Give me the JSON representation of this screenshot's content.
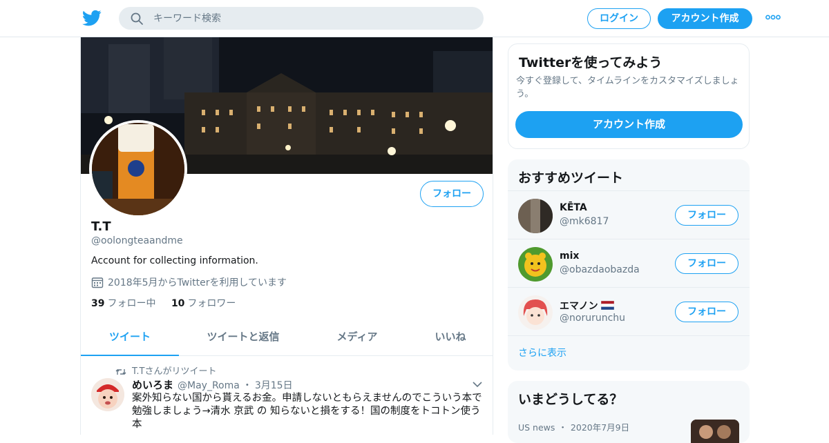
{
  "header": {
    "search_placeholder": "キーワード検索",
    "login_label": "ログイン",
    "signup_label": "アカウント作成",
    "brand_color": "#1da1f2"
  },
  "profile": {
    "name": "T.T",
    "handle": "@oolongteaandme",
    "bio": "Account for collecting information.",
    "joined": "2018年5月からTwitterを利用しています",
    "following_count": "39",
    "following_label": "フォロー中",
    "followers_count": "10",
    "followers_label": "フォロワー",
    "follow_label": "フォロー"
  },
  "tabs": [
    {
      "label": "ツイート",
      "active": true
    },
    {
      "label": "ツイートと返信",
      "active": false
    },
    {
      "label": "メディア",
      "active": false
    },
    {
      "label": "いいね",
      "active": false
    }
  ],
  "tweet": {
    "retweet_context": "T.Tさんがリツイート",
    "author_name": "めいろま",
    "author_handle": "@May_Roma",
    "separator": "・",
    "date": "3月15日",
    "text": "案外知らない国から貰えるお金。申請しないともらえませんのでこういう本で勉強しましょう→清水 京武 の 知らないと損をする！国の制度をトコトン使う本"
  },
  "signup_card": {
    "title": "Twitterを使ってみよう",
    "description": "今すぐ登録して、タイムラインをカスタマイズしましょう。",
    "button_label": "アカウント作成"
  },
  "recommended": {
    "title": "おすすめツイート",
    "users": [
      {
        "name": "KĒTA",
        "handle": "@mk6817",
        "follow_label": "フォロー"
      },
      {
        "name": "mix",
        "handle": "@obazdaobazda",
        "follow_label": "フォロー"
      },
      {
        "name": "エマノン",
        "handle": "@norurunchu",
        "follow_label": "フォロー"
      }
    ],
    "show_more": "さらに表示"
  },
  "trends": {
    "title": "いまどうしてる？",
    "item_source": "US news",
    "item_separator": "・",
    "item_date": "2020年7月9日"
  }
}
